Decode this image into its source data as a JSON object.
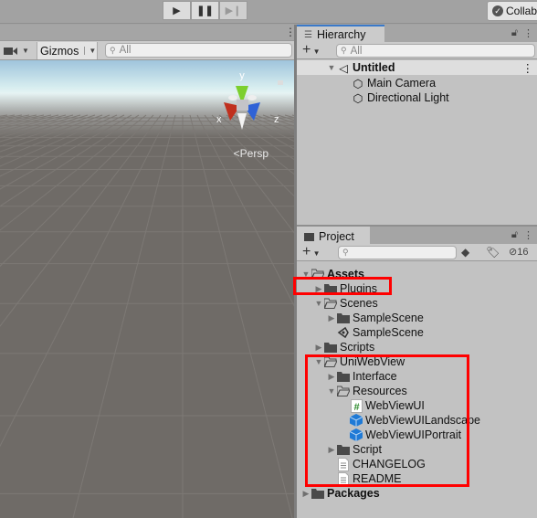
{
  "toolbar": {
    "play_icon": "play-icon",
    "pause_icon": "pause-icon",
    "step_icon": "step-icon",
    "collab_label": "Collab"
  },
  "scene": {
    "gizmos_label": "Gizmos",
    "search_placeholder": "All",
    "persp_label": "Persp",
    "axis_labels": {
      "x": "x",
      "y": "y",
      "z": "z"
    }
  },
  "hierarchy": {
    "tab_label": "Hierarchy",
    "search_placeholder": "All",
    "scene_name": "Untitled",
    "items": [
      "Main Camera",
      "Directional Light"
    ]
  },
  "project": {
    "tab_label": "Project",
    "hidden_count": "16",
    "tree": [
      {
        "label": "Assets",
        "level": 0,
        "arrow": "open",
        "icon": "folder-open",
        "bold": true
      },
      {
        "label": "Plugins",
        "level": 1,
        "arrow": "closed",
        "icon": "folder"
      },
      {
        "label": "Scenes",
        "level": 1,
        "arrow": "open",
        "icon": "folder-open"
      },
      {
        "label": "SampleScene",
        "level": 2,
        "arrow": "closed",
        "icon": "folder"
      },
      {
        "label": "SampleScene",
        "level": 2,
        "arrow": "none",
        "icon": "scene"
      },
      {
        "label": "Scripts",
        "level": 1,
        "arrow": "closed",
        "icon": "folder"
      },
      {
        "label": "UniWebView",
        "level": 1,
        "arrow": "open",
        "icon": "folder-open"
      },
      {
        "label": "Interface",
        "level": 2,
        "arrow": "closed",
        "icon": "folder"
      },
      {
        "label": "Resources",
        "level": 2,
        "arrow": "open",
        "icon": "folder-open"
      },
      {
        "label": "WebViewUI",
        "level": 3,
        "arrow": "none",
        "icon": "script"
      },
      {
        "label": "WebViewUILandscape",
        "level": 3,
        "arrow": "none",
        "icon": "prefab"
      },
      {
        "label": "WebViewUIPortrait",
        "level": 3,
        "arrow": "none",
        "icon": "prefab"
      },
      {
        "label": "Script",
        "level": 2,
        "arrow": "closed",
        "icon": "folder"
      },
      {
        "label": "CHANGELOG",
        "level": 2,
        "arrow": "none",
        "icon": "text-file"
      },
      {
        "label": "README",
        "level": 2,
        "arrow": "none",
        "icon": "text-file"
      },
      {
        "label": "Packages",
        "level": 0,
        "arrow": "closed",
        "icon": "folder",
        "bold": true
      }
    ]
  },
  "colors": {
    "highlight": "#ff0000",
    "accent": "#3a79c9",
    "prefab": "#1f7ad6"
  }
}
